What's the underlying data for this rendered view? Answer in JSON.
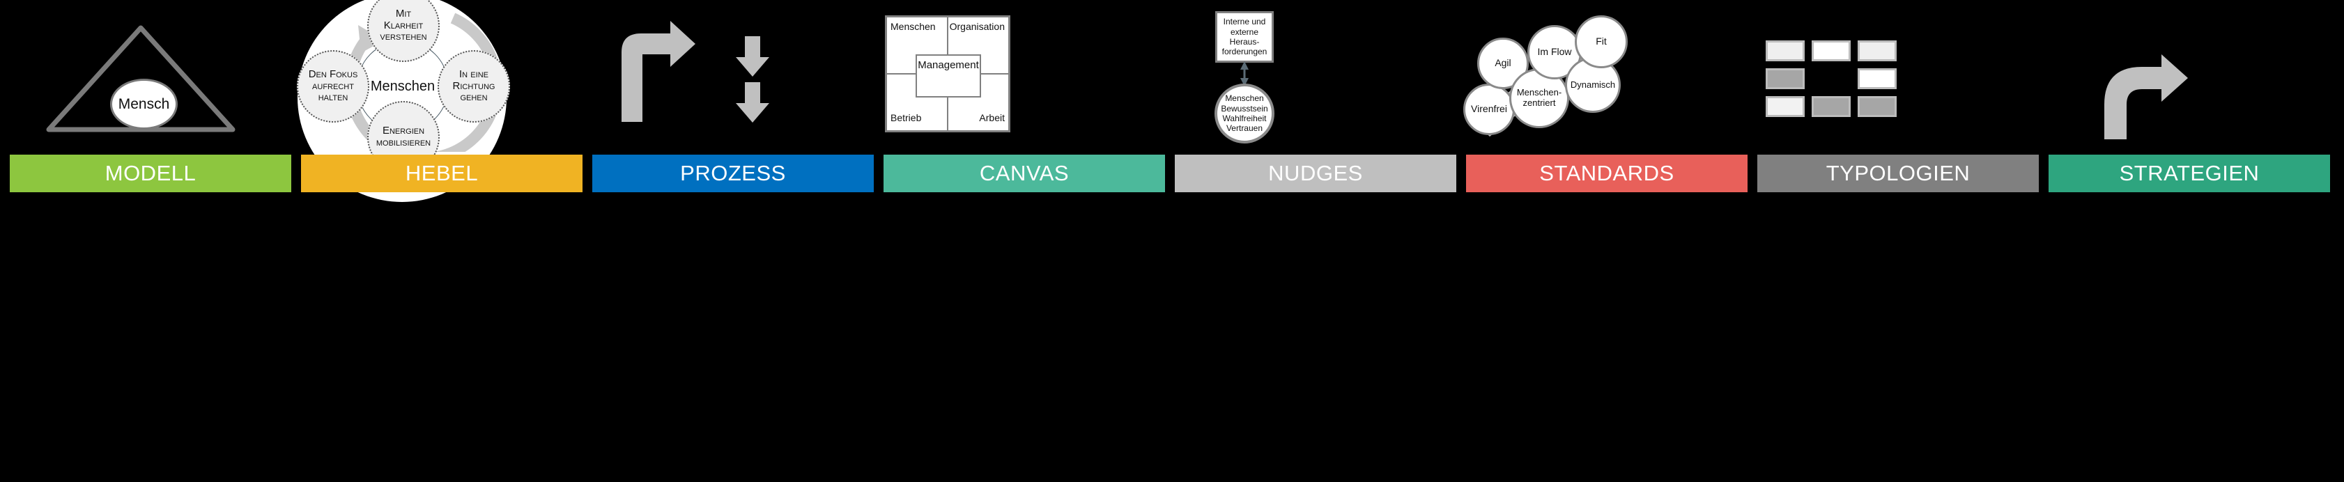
{
  "background": "#000000",
  "panels": [
    {
      "key": "modell",
      "label": "MODELL",
      "bar_color": "#8DC63F",
      "graphic": "triangle-with-center-ellipse",
      "nodes": [
        {
          "text": "Mensch"
        }
      ]
    },
    {
      "key": "hebel",
      "label": "HEBEL",
      "bar_color": "#F0B323",
      "graphic": "cycle-wheel-four-satellites",
      "center": "Menschen",
      "satellites": [
        {
          "position": "top",
          "lines": [
            "Mit",
            "Klarheit",
            "verstehen"
          ]
        },
        {
          "position": "right",
          "lines": [
            "In eine",
            "Richtung",
            "gehen"
          ]
        },
        {
          "position": "bottom",
          "lines": [
            "Energien",
            "mobilisieren"
          ]
        },
        {
          "position": "left",
          "lines": [
            "Den Fokus",
            "aufrecht",
            "halten"
          ]
        }
      ]
    },
    {
      "key": "prozess",
      "label": "PROZESS",
      "bar_color": "#0070C0",
      "graphic": "bent-arrow-and-down-arrows",
      "arrow_color": "#C0C0C0"
    },
    {
      "key": "canvas",
      "label": "CANVAS",
      "bar_color": "#4CB99B",
      "graphic": "two-by-two-grid-with-center-box",
      "quadrants": [
        {
          "position": "top-left",
          "text": "Menschen"
        },
        {
          "position": "top-right",
          "text": "Organisation"
        },
        {
          "position": "bottom-left",
          "text": "Betrieb"
        },
        {
          "position": "bottom-right",
          "text": "Arbeit"
        }
      ],
      "center_box": "Management"
    },
    {
      "key": "nudges",
      "label": "NUDGES",
      "bar_color": "#BFBFBF",
      "graphic": "box-arrow-circle",
      "box_lines": [
        "Interne und",
        "externe Heraus-",
        "forderungen"
      ],
      "circle_lines": [
        "Menschen",
        "Bewusstsein",
        "Wahlfreiheit",
        "Vertrauen"
      ],
      "connector": "double-headed-vertical-arrow"
    },
    {
      "key": "standards",
      "label": "STANDARDS",
      "bar_color": "#E8605A",
      "graphic": "rising-circles-with-arrow",
      "circles": [
        {
          "text": "Virenfrei"
        },
        {
          "text": "Agil"
        },
        {
          "text": "Menschen-\nzentriert"
        },
        {
          "text": "Im Flow"
        },
        {
          "text": "Dynamisch"
        },
        {
          "text": "Fit"
        }
      ]
    },
    {
      "key": "typologien",
      "label": "TYPOLOGIEN",
      "bar_color": "#808080",
      "graphic": "three-by-three-tile-grid",
      "tiles": [
        [
          "#EFEFEF",
          "#FFFFFF",
          "#EFEFEF"
        ],
        [
          "#A6A6A6",
          null,
          "#FFFFFF"
        ],
        [
          "#F2F2F2",
          "#A6A6A6",
          "#A6A6A6"
        ]
      ]
    },
    {
      "key": "strategien",
      "label": "STRATEGIEN",
      "bar_color": "#2EA57F",
      "graphic": "curved-arrow",
      "arrow_color": "#C0C0C0"
    }
  ]
}
